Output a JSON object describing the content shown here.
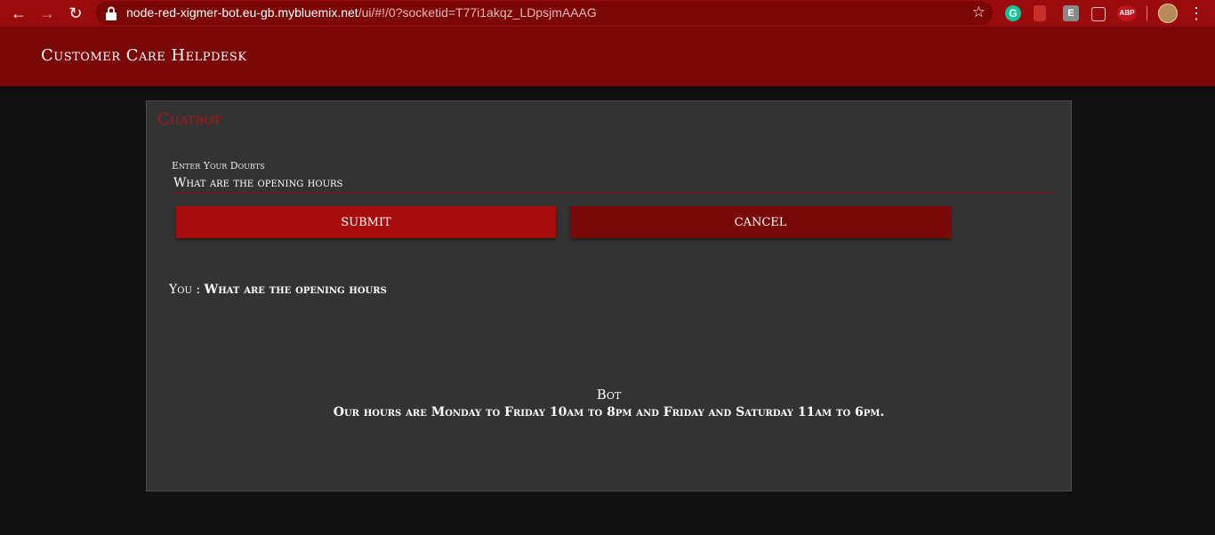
{
  "browser": {
    "url_host": "node-red-xigmer-bot.eu-gb.mybluemix.net",
    "url_path": "/ui/#!/0?socketid=T77i1akqz_LDpsjmAAAG",
    "icons": {
      "back": "back-arrow-icon",
      "forward": "forward-arrow-icon",
      "reload": "reload-icon",
      "lock": "lock-icon",
      "bookmark": "star-icon",
      "menu": "kebab-menu-icon"
    },
    "extensions": {
      "grammarly": "G",
      "e_ext": "E",
      "abp": "ABP"
    }
  },
  "header": {
    "title": "Customer Care Helpdesk"
  },
  "chat": {
    "card_title": "Chatbot",
    "input_label": "Enter Your Doubts",
    "input_value": "What are the opening hours",
    "submit_label": "SUBMIT",
    "cancel_label": "CANCEL",
    "user_prefix": "You : ",
    "user_message": "What are the opening hours",
    "bot_name": "Bot",
    "bot_reply": "Our hours are Monday to Friday 10am to 8pm and Friday and Saturday 11am to 6pm."
  },
  "colors": {
    "browser_bar": "#9a0c0c",
    "header_bg": "#7a0808",
    "card_bg": "#333333",
    "accent_red": "#b01313",
    "submit_bg": "#a80d0d",
    "cancel_bg": "#790808"
  }
}
